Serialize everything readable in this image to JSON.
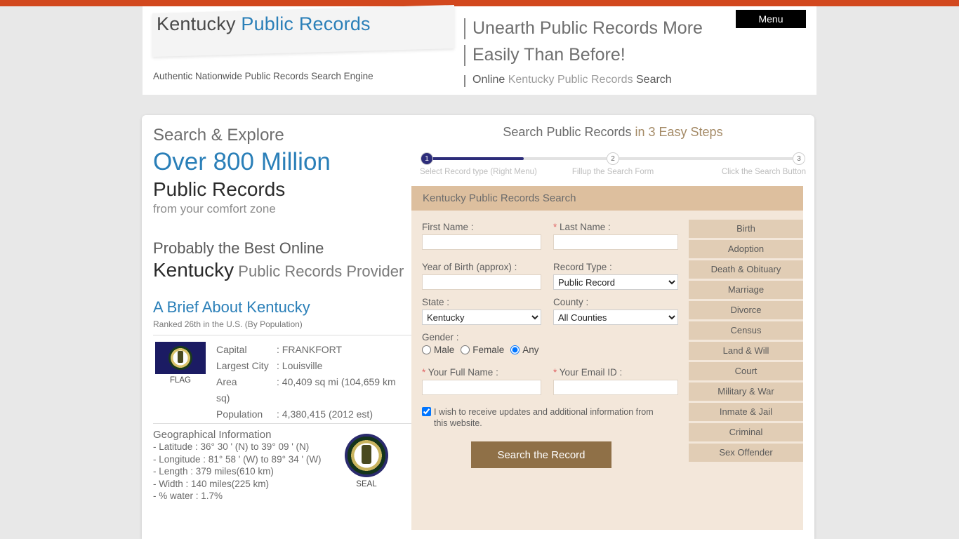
{
  "header": {
    "logo_prefix": "Kentucky ",
    "logo_suffix": "Public Records",
    "tagline": "Authentic Nationwide Public Records Search Engine",
    "hero_line1": "Unearth Public Records More",
    "hero_line2": "Easily Than Before!",
    "hero_sub_a": "Online ",
    "hero_sub_b": "Kentucky Public Records",
    "hero_sub_c": " Search",
    "menu_label": "Menu"
  },
  "left": {
    "search_explore": "Search & Explore",
    "over_million": "Over 800 Million",
    "public_records": "Public Records",
    "comfort_zone": "from your comfort zone",
    "probably_best": "Probably the Best Online",
    "ky_strong": "Kentucky",
    "ky_rest": " Public Records Provider",
    "brief_title": "A Brief About Kentucky",
    "rank": "Ranked 26th in the U.S. (By Population)",
    "flag_caption": "FLAG",
    "seal_caption": "SEAL",
    "facts": [
      {
        "key": "Capital",
        "value": ": FRANKFORT"
      },
      {
        "key": "Largest City",
        "value": ": Louisville"
      },
      {
        "key": "Area",
        "value": ": 40,409 sq mi (104,659 km sq)"
      },
      {
        "key": "Population",
        "value": ": 4,380,415 (2012 est)"
      }
    ],
    "geo_title": "Geographical Information",
    "geo_lines": [
      "- Latitude : 36° 30 ' (N) to 39° 09 ' (N)",
      "- Longitude : 81° 58 ' (W) to 89° 34 ' (W)",
      "- Length : 379 miles(610 km)",
      "- Width : 140 miles(225 km)",
      "- % water : 1.7%"
    ]
  },
  "steps": {
    "title_a": "Search Public Records ",
    "title_b": "in 3 Easy Steps",
    "nodes": [
      "1",
      "2",
      "3"
    ],
    "labels": [
      "Select Record type (Right Menu)",
      "Fillup the Search Form",
      "Click the Search Button"
    ],
    "progress_percent": 25
  },
  "form": {
    "heading": "Kentucky Public Records Search",
    "first_name_label": "First Name :",
    "first_name_value": "",
    "last_name_star": "*",
    "last_name_label": " Last Name :",
    "last_name_value": "",
    "yob_label": "Year of Birth (approx) :",
    "yob_value": "",
    "record_type_label": "Record Type :",
    "record_type_value": "Public Record",
    "record_type_options": [
      "Public Record"
    ],
    "state_label": "State :",
    "state_value": "Kentucky",
    "state_options": [
      "Kentucky"
    ],
    "county_label": "County :",
    "county_value": "All Counties",
    "county_options": [
      "All Counties"
    ],
    "gender_label": "Gender :",
    "gender_options": [
      "Male",
      "Female",
      "Any"
    ],
    "gender_selected": "Any",
    "full_name_star": "*",
    "full_name_label": " Your Full Name :",
    "full_name_value": "",
    "email_star": "*",
    "email_label": " Your Email ID :",
    "email_value": "",
    "opt_in_text": "I wish to receive updates and additional information from this website.",
    "opt_in_checked": true,
    "submit_label": "Search the Record"
  },
  "side_menu": {
    "items": [
      "Birth",
      "Adoption",
      "Death & Obituary",
      "Marriage",
      "Divorce",
      "Census",
      "Land & Will",
      "Court",
      "Military & War",
      "Inmate & Jail",
      "Criminal",
      "Sex Offender"
    ]
  },
  "colors": {
    "topbar": "#d2481e",
    "accent_blue": "#2a7fb8",
    "form_header": "#ddbf9e",
    "form_body": "#f3e7da",
    "menu_item": "#e1cdb5",
    "submit": "#8f7047",
    "progress": "#2d2d7a"
  }
}
